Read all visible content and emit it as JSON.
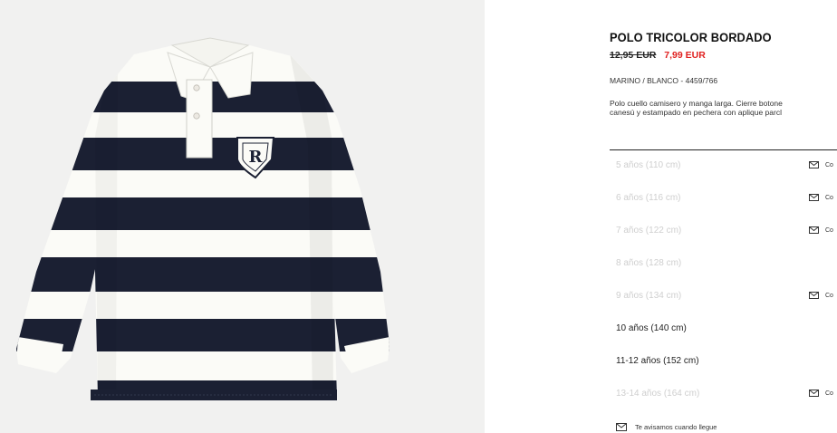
{
  "product": {
    "name": "POLO TRICOLOR BORDADO",
    "old_price": "12,95 EUR",
    "sale_price": "7,99 EUR",
    "reference": "MARINO / BLANCO - 4459/766",
    "description_line1": "Polo cuello camisero y manga larga. Cierre botone",
    "description_line2": "canesú y estampado en pechera con aplique parcl"
  },
  "sizes": [
    {
      "label": "5 años (110 cm)",
      "available": false,
      "notify": "Co"
    },
    {
      "label": "6 años (116 cm)",
      "available": false,
      "notify": "Co"
    },
    {
      "label": "7 años (122 cm)",
      "available": false,
      "notify": "Co"
    },
    {
      "label": "8 años (128 cm)",
      "available": false,
      "notify": ""
    },
    {
      "label": "9 años (134 cm)",
      "available": false,
      "notify": "Co"
    },
    {
      "label": "10 años (140 cm)",
      "available": true,
      "notify": ""
    },
    {
      "label": "11-12 años (152 cm)",
      "available": true,
      "notify": ""
    },
    {
      "label": "13-14 años (164 cm)",
      "available": false,
      "notify": "Co"
    }
  ],
  "notify_note": "Te avisamos cuando llegue",
  "colors": {
    "sale": "#e0201f",
    "navy": "#1b2033",
    "cream": "#fbfbf7",
    "unavailable_text": "#cfcfcf",
    "background": "#f1f1f0"
  },
  "icons": {
    "notify": "envelope-icon",
    "crest": "crest-icon"
  }
}
